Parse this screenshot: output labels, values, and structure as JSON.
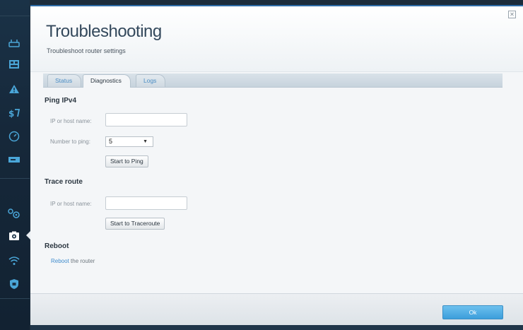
{
  "sidebar": {
    "icons": [
      "smart-wifi-icon",
      "network-map-icon",
      "alert-icon",
      "media-prioritization-icon",
      "speed-test-icon",
      "external-storage-icon",
      "settings-gears-icon",
      "troubleshooting-icon",
      "wireless-icon",
      "security-icon"
    ]
  },
  "header": {
    "title": "Troubleshooting",
    "subtitle": "Troubleshoot router settings"
  },
  "tabs": [
    {
      "label": "Status"
    },
    {
      "label": "Diagnostics"
    },
    {
      "label": "Logs"
    }
  ],
  "active_tab": "Diagnostics",
  "ping": {
    "title": "Ping IPv4",
    "host_label": "IP or host name:",
    "host_value": "",
    "count_label": "Number to ping:",
    "count_value": "5",
    "button": "Start to Ping"
  },
  "trace": {
    "title": "Trace route",
    "host_label": "IP or host name:",
    "host_value": "",
    "button": "Start to Traceroute"
  },
  "reboot": {
    "title": "Reboot",
    "link": "Reboot",
    "text": " the router"
  },
  "footer": {
    "ok_label": "Ok"
  },
  "colors": {
    "accent": "#4aa6d8",
    "link": "#3f8ccd",
    "ok_button": "#3c9edb"
  }
}
